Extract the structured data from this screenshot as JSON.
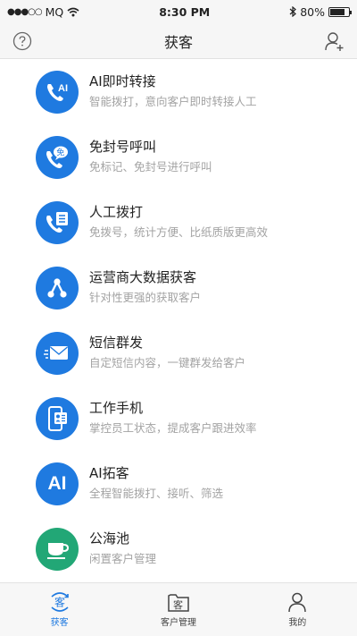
{
  "status_bar": {
    "carrier": "MQ",
    "time": "8:30 PM",
    "battery_percent": "80%",
    "battery_level": 0.8
  },
  "nav": {
    "title": "获客"
  },
  "items": [
    {
      "title": "AI即时转接",
      "subtitle": "智能拨打，意向客户即时转接人工",
      "icon": "ai-phone-icon"
    },
    {
      "title": "免封号呼叫",
      "subtitle": "免标记、免封号进行呼叫",
      "icon": "free-call-icon"
    },
    {
      "title": "人工拨打",
      "subtitle": "免拨号，统计方便、比纸质版更高效",
      "icon": "manual-dial-icon"
    },
    {
      "title": "运营商大数据获客",
      "subtitle": "针对性更强的获取客户",
      "icon": "big-data-icon"
    },
    {
      "title": "短信群发",
      "subtitle": "自定短信内容，一键群发给客户",
      "icon": "sms-icon"
    },
    {
      "title": "工作手机",
      "subtitle": "掌控员工状态，提成客户跟进效率",
      "icon": "work-phone-icon"
    },
    {
      "title": "AI拓客",
      "subtitle": "全程智能拨打、接听、筛选",
      "icon": "ai-expand-icon"
    },
    {
      "title": "公海池",
      "subtitle": "闲置客户管理",
      "icon": "public-pool-icon"
    }
  ],
  "item_icon_text": {
    "ai": "AI",
    "free": "免",
    "ai_big": "AI"
  },
  "tabs": [
    {
      "label": "获客",
      "icon_text": "客",
      "active": true
    },
    {
      "label": "客户管理",
      "icon_text": "客",
      "active": false
    },
    {
      "label": "我的",
      "active": false
    }
  ],
  "colors": {
    "accent_blue": "#1f7ae0",
    "accent_green": "#22a776"
  }
}
